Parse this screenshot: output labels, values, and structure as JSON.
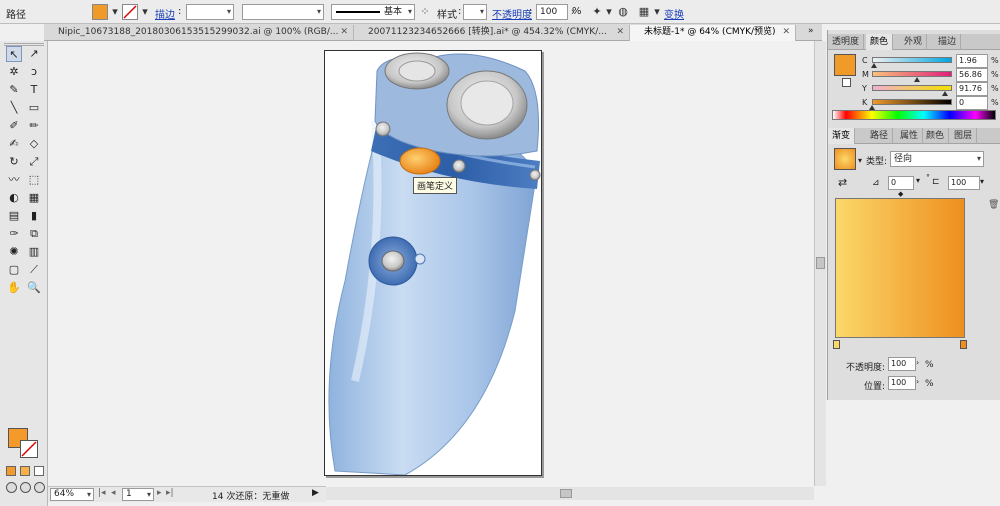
{
  "control_bar": {
    "label": "路径",
    "fill_color": "#f09a2a",
    "stroke_label": "描边",
    "stroke_value": "",
    "brush_value": "基本",
    "style_label": "样式",
    "opacity_label": "不透明度",
    "opacity_value": "100",
    "opacity_unit": "%",
    "transform_label": "变换"
  },
  "doc_tabs": [
    {
      "label": "Nipic_10673188_20180306153515299032.ai @ 100% (RGB/...",
      "close": "✕"
    },
    {
      "label": "20071123234652666 [转换].ai* @ 454.32% (CMYK/...",
      "close": "✕"
    },
    {
      "label": "未标题-1* @ 64% (CMYK/预览)",
      "close": "✕"
    }
  ],
  "tooltip": "画笔定义",
  "status_bar": {
    "zoom": "64%",
    "page": "1",
    "history": "14 次还原：无重做"
  },
  "color_panel": {
    "tabs": [
      "透明度",
      "颜色",
      "外观",
      "描边"
    ],
    "active_tab": 1,
    "swatch": "#f09a2a",
    "channels": [
      {
        "label": "C",
        "value": "1.96",
        "fraction": 0.0196
      },
      {
        "label": "M",
        "value": "56.86",
        "fraction": 0.5686
      },
      {
        "label": "Y",
        "value": "91.76",
        "fraction": 0.9176
      },
      {
        "label": "K",
        "value": "0",
        "fraction": 0
      }
    ],
    "unit": "%"
  },
  "gradient_panel": {
    "tabs": [
      "渐变",
      "路径",
      "属性",
      "颜色",
      "图层"
    ],
    "active_tab": 0,
    "type_label": "类型:",
    "type_value": "径向",
    "angle_value": "0",
    "aspect_value": "100",
    "opacity_label": "不透明度:",
    "opacity_value": "100",
    "position_label": "位置:",
    "position_value": "100",
    "unit": "%",
    "color_start": "#fbd86a",
    "color_end": "#ee8f1f"
  },
  "toolbox": {
    "fill_color": "#f39a2a",
    "tools": [
      "selection-tool",
      "direct-selection-tool",
      "magic-wand-tool",
      "lasso-tool",
      "pen-tool",
      "type-tool",
      "line-tool",
      "rectangle-tool",
      "paintbrush-tool",
      "pencil-tool",
      "blob-brush-tool",
      "eraser-tool",
      "rotate-tool",
      "scale-tool",
      "warp-tool",
      "free-transform-tool",
      "shape-builder-tool",
      "perspective-grid-tool",
      "mesh-tool",
      "gradient-tool",
      "eyedropper-tool",
      "blend-tool",
      "symbol-sprayer-tool",
      "column-graph-tool",
      "artboard-tool",
      "slice-tool",
      "hand-tool",
      "zoom-tool"
    ]
  }
}
